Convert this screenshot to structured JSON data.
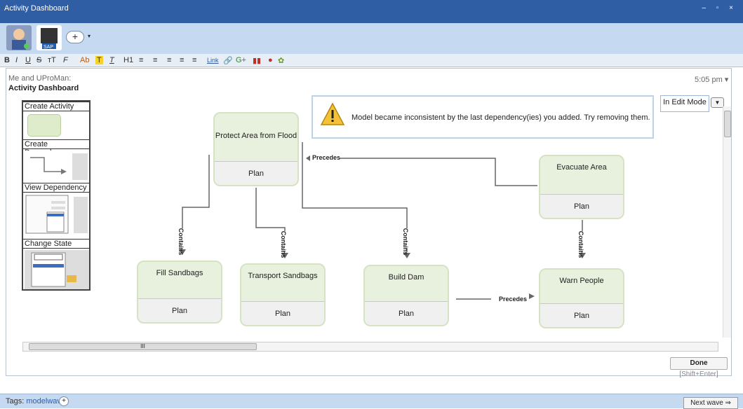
{
  "window": {
    "title": "Activity Dashboard",
    "controls": "– ▫ ×"
  },
  "toolbar": {
    "add_label": "+",
    "add_dropdown": "▾",
    "format": [
      "B",
      "I",
      "U",
      "S",
      "тT",
      "F",
      "Ab",
      "T",
      "T",
      "H1",
      "≡",
      "≡",
      "≡",
      "≡",
      "≡",
      "Link",
      "🔗",
      "G+",
      "▮▮",
      "●",
      "✿"
    ]
  },
  "wave": {
    "participants": "Me and UProMan:",
    "title": "Activity Dashboard",
    "time": "5:05 pm ▾",
    "edit_mode": "In Edit Mode"
  },
  "palette": {
    "items": [
      "Create Activity",
      "Create Dependency",
      "View Dependency",
      "Change State"
    ]
  },
  "warning": {
    "message": "Model became inconsistent by the last dependency(ies) you added. Try removing them."
  },
  "activities": [
    {
      "name": "Protect Area from Flood",
      "state": "Plan"
    },
    {
      "name": "Evacuate Area",
      "state": "Plan"
    },
    {
      "name": "Fill Sandbags",
      "state": "Plan"
    },
    {
      "name": "Transport Sandbags",
      "state": "Plan"
    },
    {
      "name": "Build Dam",
      "state": "Plan"
    },
    {
      "name": "Warn People",
      "state": "Plan"
    }
  ],
  "links": {
    "contains": "Contains",
    "precedes": "Precedes"
  },
  "scroll": {
    "thumb": "III"
  },
  "done": {
    "label": "Done",
    "shortcut": "[Shift+Enter]"
  },
  "footer": {
    "tags_label": "Tags:",
    "tag": "modelwave",
    "next": "Next wave ⇒"
  }
}
